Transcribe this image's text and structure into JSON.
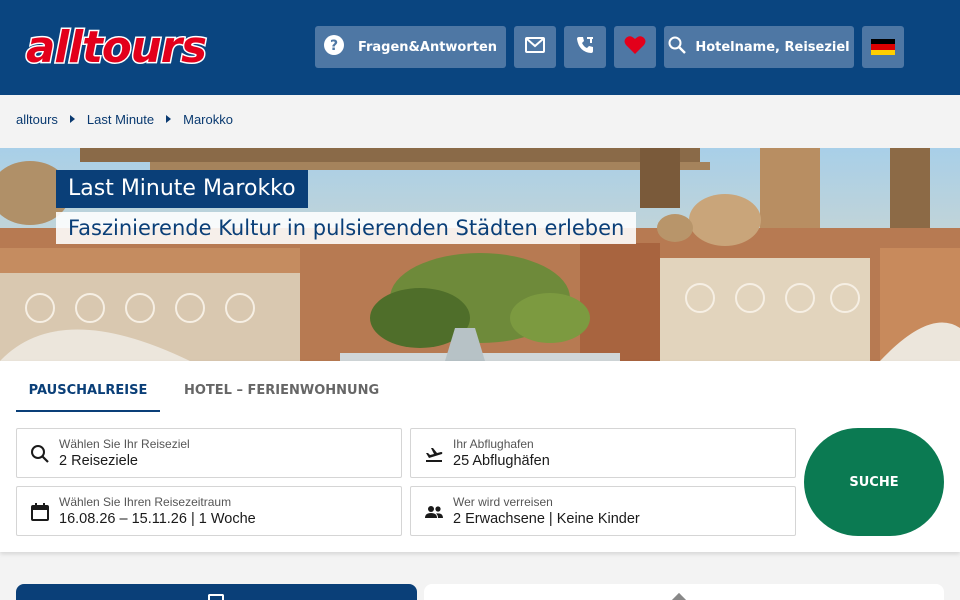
{
  "header": {
    "logo_text": "alltours",
    "faq_label": "Fragen&Antworten",
    "search_label": "Hotelname, Reiseziel",
    "colors": {
      "background": "#0a4580",
      "button": "#4e77a4",
      "logo": "#e3001b",
      "heart": "#e3001b"
    },
    "icons": [
      "question-circle-icon",
      "mail-icon",
      "phone-icon",
      "heart-icon",
      "search-icon",
      "germany-flag-icon"
    ]
  },
  "breadcrumb": {
    "items": [
      "alltours",
      "Last Minute",
      "Marokko"
    ]
  },
  "hero": {
    "title": "Last Minute Marokko",
    "subtitle": "Faszinierende Kultur in pulsierenden Städten erleben"
  },
  "search": {
    "tabs": [
      "PAUSCHALREISE",
      "HOTEL – FERIENWOHNUNG"
    ],
    "active_tab": "PAUSCHALREISE",
    "fields": {
      "destination": {
        "label": "Wählen Sie Ihr Reiseziel",
        "value": "2 Reiseziele"
      },
      "airport": {
        "label": "Ihr Abflughafen",
        "value": "25 Abflughäfen"
      },
      "dates": {
        "label": "Wählen Sie Ihren Reisezeitraum",
        "value": "16.08.26 – 15.11.26 | 1 Woche"
      },
      "travellers": {
        "label": "Wer wird verreisen",
        "value": "2 Erwachsene | Keine Kinder"
      }
    },
    "submit_label": "SUCHE",
    "colors": {
      "submit": "#0b7a52",
      "active_tab": "#0a3f78"
    }
  }
}
